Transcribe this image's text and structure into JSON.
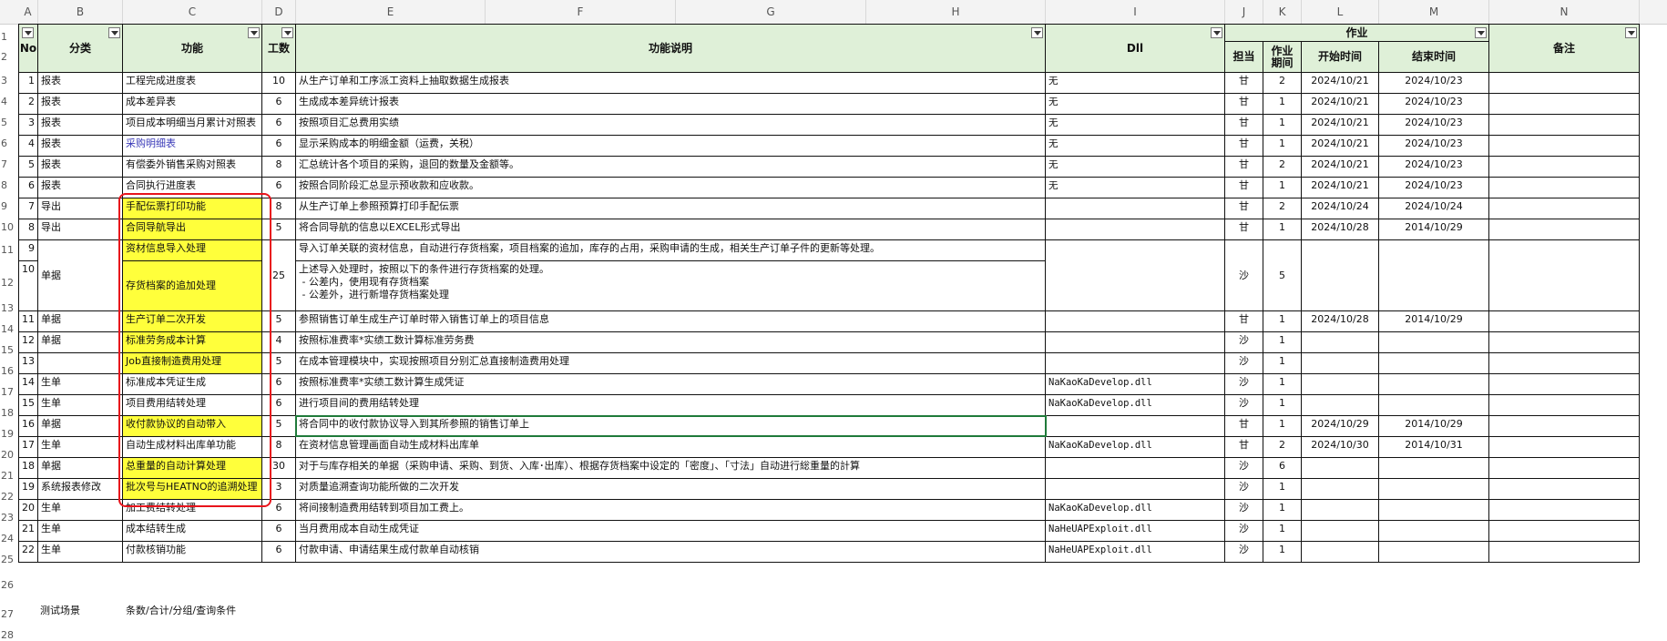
{
  "columns": [
    "A",
    "B",
    "C",
    "D",
    "E",
    "F",
    "G",
    "H",
    "I",
    "J",
    "K",
    "L",
    "M",
    "N"
  ],
  "row_numbers": [
    "1",
    "2",
    "3",
    "4",
    "5",
    "6",
    "7",
    "8",
    "9",
    "10",
    "11",
    "12",
    "13",
    "14",
    "15",
    "16",
    "17",
    "18",
    "19",
    "20",
    "21",
    "22",
    "23",
    "24",
    "25",
    "26",
    "27",
    "28"
  ],
  "header": {
    "no": "No",
    "category": "分类",
    "function": "功能",
    "hours": "工数",
    "description": "功能说明",
    "dll": "Dll",
    "work": "作业",
    "owner": "担当",
    "period": "作业期间",
    "start": "开始时间",
    "end": "结束时间",
    "remarks": "备注"
  },
  "rows": [
    {
      "no": "1",
      "cat": "报表",
      "func": "工程完成进度表",
      "hours": "10",
      "desc": "从生产订单和工序派工资料上抽取数据生成报表",
      "dll": "无",
      "owner": "甘",
      "period": "2",
      "start": "2024/10/21",
      "end": "2024/10/23"
    },
    {
      "no": "2",
      "cat": "报表",
      "func": "成本差异表",
      "hours": "6",
      "desc": "生成成本差异统计报表",
      "dll": "无",
      "owner": "甘",
      "period": "1",
      "start": "2024/10/21",
      "end": "2024/10/23"
    },
    {
      "no": "3",
      "cat": "报表",
      "func": "项目成本明细当月累计对照表",
      "hours": "6",
      "desc": "按照项目汇总费用实绩",
      "dll": "无",
      "owner": "甘",
      "period": "1",
      "start": "2024/10/21",
      "end": "2024/10/23"
    },
    {
      "no": "4",
      "cat": "报表",
      "func": "采购明细表",
      "hours": "6",
      "desc": "显示采购成本的明细金额（运费，关税）",
      "dll": "无",
      "owner": "甘",
      "period": "1",
      "start": "2024/10/21",
      "end": "2024/10/23"
    },
    {
      "no": "5",
      "cat": "报表",
      "func": "有偿委外销售采购对照表",
      "hours": "8",
      "desc": "汇总统计各个项目的采购，退回的数量及金额等。",
      "dll": "无",
      "owner": "甘",
      "period": "2",
      "start": "2024/10/21",
      "end": "2024/10/23"
    },
    {
      "no": "6",
      "cat": "报表",
      "func": "合同执行进度表",
      "hours": "6",
      "desc": "按照合同阶段汇总显示预收款和应收款。",
      "dll": "无",
      "owner": "甘",
      "period": "1",
      "start": "2024/10/21",
      "end": "2024/10/23"
    },
    {
      "no": "7",
      "cat": "导出",
      "func": "手配伝票打印功能",
      "hours": "8",
      "desc": "从生产订单上参照预算打印手配伝票",
      "dll": "",
      "owner": "甘",
      "period": "2",
      "start": "2024/10/24",
      "end": "2024/10/24"
    },
    {
      "no": "8",
      "cat": "导出",
      "func": "合同导航导出",
      "hours": "5",
      "desc": "将合同导航的信息以EXCEL形式导出",
      "dll": "",
      "owner": "甘",
      "period": "1",
      "start": "2024/10/28",
      "end": "2014/10/29"
    },
    {
      "no": "11",
      "cat": "单据",
      "func": "生产订单二次开发",
      "hours": "5",
      "desc": "参照销售订单生成生产订单时带入销售订单上的项目信息",
      "dll": "",
      "owner": "甘",
      "period": "1",
      "start": "2024/10/28",
      "end": "2014/10/29"
    },
    {
      "no": "12",
      "cat": "单据",
      "func": "标准劳务成本计算",
      "hours": "4",
      "desc": "按照标准费率*实绩工数计算标准劳务费",
      "dll": "",
      "owner": "沙",
      "period": "1",
      "start": "",
      "end": ""
    },
    {
      "no": "13",
      "cat": "",
      "func": "Job直接制造费用处理",
      "hours": "5",
      "desc": "在成本管理模块中，实现按照项目分别汇总直接制造费用处理",
      "dll": "",
      "owner": "沙",
      "period": "1",
      "start": "",
      "end": ""
    },
    {
      "no": "14",
      "cat": "生单",
      "func": "标准成本凭证生成",
      "hours": "6",
      "desc": "按照标准费率*实绩工数计算生成凭证",
      "dll": "NaKaoKaDevelop.dll",
      "owner": "沙",
      "period": "1",
      "start": "",
      "end": ""
    },
    {
      "no": "15",
      "cat": "生单",
      "func": "项目费用结转处理",
      "hours": "6",
      "desc": "进行项目间的费用结转处理",
      "dll": "NaKaoKaDevelop.dll",
      "owner": "沙",
      "period": "1",
      "start": "",
      "end": ""
    },
    {
      "no": "16",
      "cat": "单据",
      "func": "收付款协议的自动带入",
      "hours": "5",
      "desc": "将合同中的收付款协议导入到其所参照的销售订单上",
      "dll": "",
      "owner": "甘",
      "period": "1",
      "start": "2024/10/29",
      "end": "2014/10/29"
    },
    {
      "no": "17",
      "cat": "生单",
      "func": "自动生成材料出库单功能",
      "hours": "8",
      "desc": "在资材信息管理画面自动生成材料出库单",
      "dll": "NaKaoKaDevelop.dll",
      "owner": "甘",
      "period": "2",
      "start": "2024/10/30",
      "end": "2014/10/31"
    },
    {
      "no": "18",
      "cat": "单据",
      "func": "总重量的自动计算处理",
      "hours": "30",
      "desc": "对于与库存相关的单据（采购申请、采购、到货、入库･出库）、根据存货档案中设定的「密度」、「寸法」自动进行総重量的計算",
      "dll": "",
      "owner": "沙",
      "period": "6",
      "start": "",
      "end": ""
    },
    {
      "no": "19",
      "cat": "系统报表修改",
      "func": "批次号与HEATNO的追溯处理",
      "hours": "3",
      "desc": "对质量追溯查询功能所做的二次开发",
      "dll": "",
      "owner": "沙",
      "period": "1",
      "start": "",
      "end": ""
    },
    {
      "no": "20",
      "cat": "生单",
      "func": "加工费结转处理",
      "hours": "6",
      "desc": "将间接制造费用结转到项目加工费上。",
      "dll": "NaKaoKaDevelop.dll",
      "owner": "沙",
      "period": "1",
      "start": "",
      "end": ""
    },
    {
      "no": "21",
      "cat": "生单",
      "func": "成本结转生成",
      "hours": "6",
      "desc": "当月费用成本自动生成凭证",
      "dll": "NaHeUAPExploit.dll",
      "owner": "沙",
      "period": "1",
      "start": "",
      "end": ""
    },
    {
      "no": "22",
      "cat": "生单",
      "func": "付款核销功能",
      "hours": "6",
      "desc": "付款申请、申请结果生成付款单自动核销",
      "dll": "NaHeUAPExploit.dll",
      "owner": "沙",
      "period": "1",
      "start": "",
      "end": ""
    }
  ],
  "merged_9_10": {
    "no_top": "9",
    "no_bottom": "10",
    "cat": "单据",
    "func_top": "资材信息导入处理",
    "func_bottom": "存货档案的追加处理",
    "hours": "25",
    "desc_top": "导入订单关联的资材信息，自动进行存货档案，项目档案的追加，库存的占用，采购申请的生成，相关生产订单子件的更新等处理。",
    "desc_bottom": [
      "上述导入处理时，按照以下的条件进行存货档案的处理。",
      " - 公差内，使用现有存货档案",
      " - 公差外，进行新增存货档案处理"
    ],
    "owner": "沙",
    "period": "5"
  },
  "footer": {
    "label": "测试场景",
    "value": "条数/合计/分组/查询条件"
  },
  "highlight_color": "#ffff3b",
  "header_color": "#dff0d8"
}
